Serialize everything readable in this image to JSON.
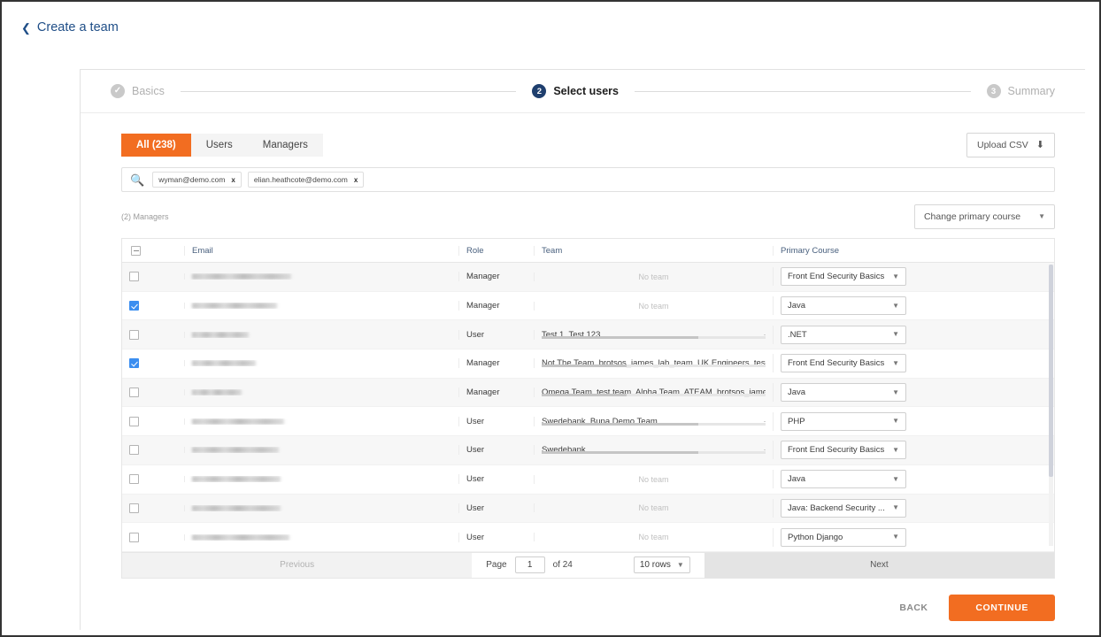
{
  "header": {
    "back_label": "Create a team",
    "back_chevron": "chevron-left-icon"
  },
  "stepper": {
    "steps": [
      {
        "num": "✓",
        "label": "Basics",
        "state": "done"
      },
      {
        "num": "2",
        "label": "Select users",
        "state": "active"
      },
      {
        "num": "3",
        "label": "Summary",
        "state": "todo"
      }
    ]
  },
  "tabs": [
    {
      "label": "All (238)",
      "active": true
    },
    {
      "label": "Users",
      "active": false
    },
    {
      "label": "Managers",
      "active": false
    }
  ],
  "upload": {
    "label": "Upload CSV",
    "icon": "upload-icon"
  },
  "search": {
    "icon": "search-icon",
    "placeholder": "",
    "value": "",
    "chips": [
      {
        "label": "wyman@demo.com",
        "remove": "x"
      },
      {
        "label": "elian.heathcote@demo.com",
        "remove": "x"
      }
    ]
  },
  "meta": {
    "count_label": "(2) Managers",
    "change_course_label": "Change primary course",
    "caret": "chevron-down-icon"
  },
  "table": {
    "columns": [
      "",
      "Email",
      "Role",
      "Team",
      "Primary Course"
    ],
    "header_checkbox_state": "indeterminate",
    "rows": [
      {
        "checked": false,
        "email": "",
        "email_w": 112,
        "role": "Manager",
        "team": "",
        "team_none": "No team",
        "course": "Front End Security Basics"
      },
      {
        "checked": true,
        "email": "",
        "email_w": 96,
        "role": "Manager",
        "team": "",
        "team_none": "No team",
        "course": "Java"
      },
      {
        "checked": false,
        "email": "",
        "email_w": 64,
        "role": "User",
        "team": "Test 1, Test 123",
        "team_none": "",
        "course": ".NET"
      },
      {
        "checked": true,
        "email": "",
        "email_w": 72,
        "role": "Manager",
        "team": "Not The Team, brotsos_james_lab_team, UK Engineers, test team, Fragile",
        "team_none": "",
        "course": "Front End Security Basics"
      },
      {
        "checked": false,
        "email": "",
        "email_w": 56,
        "role": "Manager",
        "team": "Omega Team, test team, Alpha Team, ATEAM, brotsos_james_lab_team, F",
        "team_none": "",
        "course": "Java"
      },
      {
        "checked": false,
        "email": "",
        "email_w": 104,
        "role": "User",
        "team": "Swedebank, Bupa Demo Team",
        "team_none": "",
        "course": "PHP"
      },
      {
        "checked": false,
        "email": "",
        "email_w": 98,
        "role": "User",
        "team": "Swedebank",
        "team_none": "",
        "course": "Front End Security Basics"
      },
      {
        "checked": false,
        "email": "",
        "email_w": 100,
        "role": "User",
        "team": "",
        "team_none": "No team",
        "course": "Java"
      },
      {
        "checked": false,
        "email": "",
        "email_w": 100,
        "role": "User",
        "team": "",
        "team_none": "No team",
        "course": "Java: Backend Security ..."
      },
      {
        "checked": false,
        "email": "",
        "email_w": 110,
        "role": "User",
        "team": "",
        "team_none": "No team",
        "course": "Python Django"
      }
    ]
  },
  "pager": {
    "previous_label": "Previous",
    "page_label": "Page",
    "page_value": "1",
    "of_label": "of 24",
    "rows_label": "10 rows",
    "rows_caret": "chevron-down-icon",
    "next_label": "Next"
  },
  "footer": {
    "back_label": "BACK",
    "continue_label": "CONTINUE"
  },
  "colors": {
    "accent_orange": "#f26d21",
    "step_active": "#1f3f6e",
    "link_blue": "#1f4e87",
    "checkbox_blue": "#3b8ef0"
  }
}
